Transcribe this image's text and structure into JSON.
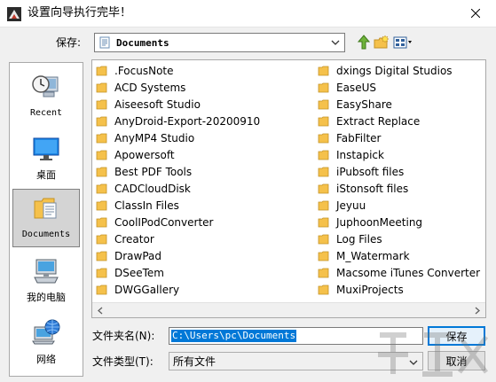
{
  "window": {
    "title": "设置向导执行完毕！"
  },
  "look_in": {
    "label": "保存:",
    "value": "Documents"
  },
  "places": [
    {
      "label": "Recent",
      "icon": "recent-icon",
      "selected": false
    },
    {
      "label": "桌面",
      "icon": "desktop-icon",
      "selected": false
    },
    {
      "label": "Documents",
      "icon": "documents-icon",
      "selected": true
    },
    {
      "label": "我的电脑",
      "icon": "computer-icon",
      "selected": false
    },
    {
      "label": "网络",
      "icon": "network-icon",
      "selected": false
    }
  ],
  "files_left": [
    ".FocusNote",
    "ACD Systems",
    "Aiseesoft Studio",
    "AnyDroid-Export-20200910",
    "AnyMP4 Studio",
    "Apowersoft",
    "Best PDF Tools",
    "CADCloudDisk",
    "ClassIn Files",
    "CoolIPodConverter",
    "Creator",
    "DrawPad",
    "DSeeTem",
    "DWGGallery"
  ],
  "files_right": [
    "dxings Digital Studios",
    "EaseUS",
    "EasyShare",
    "Extract Replace",
    "FabFilter",
    "Instapick",
    "iPubsoft files",
    "iStonsoft files",
    "Jeyuu",
    "JuphoonMeeting",
    "Log Files",
    "M_Watermark",
    "Macsome iTunes Converter",
    "MuxiProjects"
  ],
  "file_name": {
    "label": "文件夹名(N):",
    "value": "C:\\Users\\pc\\Documents"
  },
  "file_type": {
    "label": "文件类型(T):",
    "value": "所有文件"
  },
  "buttons": {
    "save": "保存",
    "cancel": "取消"
  },
  "colors": {
    "folder": "#f5c14b",
    "selection": "#0078d7",
    "accent": "#0078d7"
  }
}
